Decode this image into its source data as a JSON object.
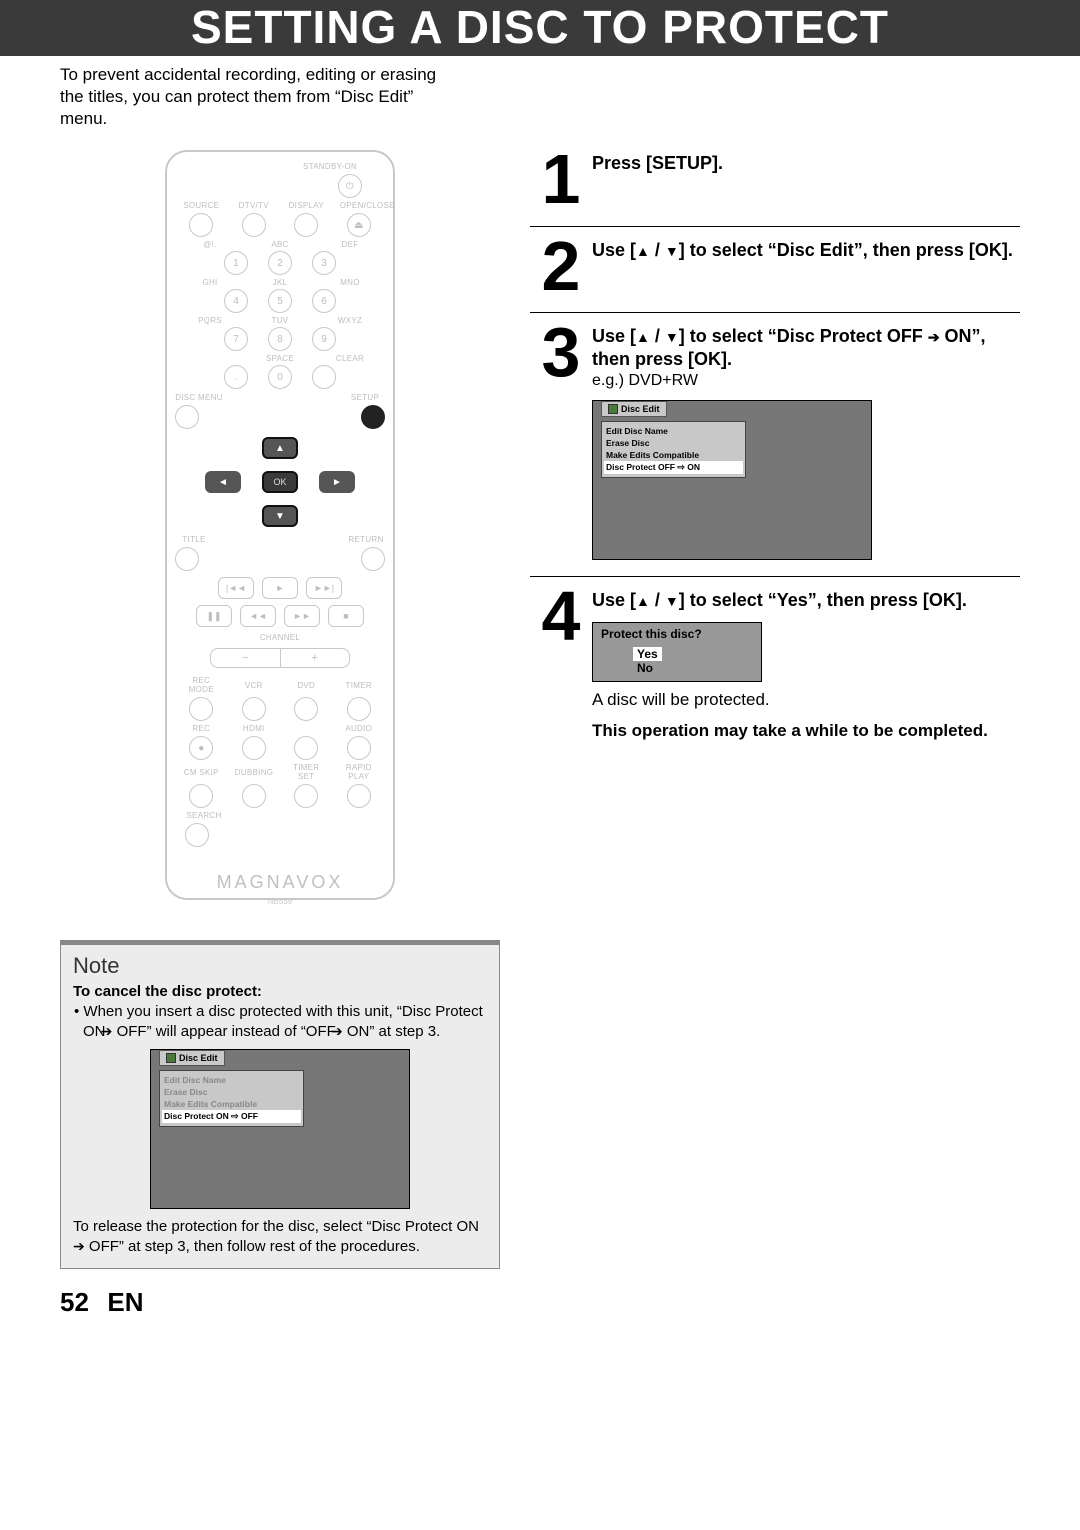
{
  "page": {
    "title": "SETTING A DISC TO PROTECT",
    "intro": "To prevent accidental recording, editing or erasing the titles, you can protect them from “Disc Edit” menu.",
    "page_number": "52",
    "lang": "EN"
  },
  "remote": {
    "brand": "MAGNAVOX",
    "model": "NB559",
    "labels": {
      "standby": "STANDBY-ON",
      "source": "SOURCE",
      "dtvtv": "DTV/TV",
      "display": "DISPLAY",
      "openclose": "OPEN/CLOSE",
      "at": "@!.",
      "abc": "ABC",
      "def": "DEF",
      "ghi": "GHI",
      "jkl": "JKL",
      "mno": "MNO",
      "pqrs": "PQRS",
      "tuv": "TUV",
      "wxyz": "WXYZ",
      "space": "SPACE",
      "clear": "CLEAR",
      "discmenu": "DISC MENU",
      "setup": "SETUP",
      "title": "TITLE",
      "return": "RETURN",
      "ok": "OK",
      "channel": "CHANNEL",
      "recmode": "REC MODE",
      "vcr": "VCR",
      "dvd": "DVD",
      "timer": "TIMER",
      "rec": "REC",
      "hdmi": "HDMI",
      "audio": "AUDIO",
      "cmskip": "CM SKIP",
      "dubbing": "DUBBING",
      "timerset": "TIMER SET",
      "rapidplay": "RAPID PLAY",
      "search": "SEARCH"
    },
    "numbers": {
      "n1": "1",
      "n2": "2",
      "n3": "3",
      "n4": "4",
      "n5": "5",
      "n6": "6",
      "n7": "7",
      "n8": "8",
      "n9": "9",
      "n0": "0",
      "dot": "."
    }
  },
  "steps": {
    "s1": {
      "num": "1",
      "title": "Press [SETUP]."
    },
    "s2": {
      "num": "2",
      "title_pre": "Use [",
      "title_mid": " / ",
      "title_post": "] to select “Disc Edit”, then press [OK]."
    },
    "s3": {
      "num": "3",
      "title_pre": "Use [",
      "title_mid": " / ",
      "title_post": "] to select “Disc Protect OFF ",
      "title_post2": " ON”, then press [OK].",
      "sub": "e.g.) DVD+RW",
      "menu": {
        "header": "Disc Edit",
        "opt1": "Edit Disc Name",
        "opt2": "Erase Disc",
        "opt3": "Make Edits Compatible",
        "opt4_pre": "Disc Protect OFF ",
        "opt4_post": " ON"
      }
    },
    "s4": {
      "num": "4",
      "title_pre": "Use [",
      "title_mid": " / ",
      "title_post": "] to select “Yes”, then press [OK].",
      "confirm_header": "Protect this disc?",
      "yes": "Yes",
      "no": "No",
      "after": "A disc will be protected.",
      "note": "This operation may take a while to be completed."
    }
  },
  "notebox": {
    "header": "Note",
    "cancel_h": "To cancel the disc protect:",
    "bullet_pre": "When you insert a disc protected with this unit, “Disc Protect ON ",
    "bullet_mid": " OFF” will appear instead of “OFF ",
    "bullet_post": " ON” at step 3.",
    "menu": {
      "header": "Disc Edit",
      "opt1": "Edit Disc Name",
      "opt2": "Erase Disc",
      "opt3": "Make Edits Compatible",
      "opt4_pre": "Disc Protect ON ",
      "opt4_post": " OFF"
    },
    "after_pre": "To release the protection for the disc, select “Disc Protect ON ",
    "after_post": " OFF” at step 3, then follow rest of the procedures."
  }
}
